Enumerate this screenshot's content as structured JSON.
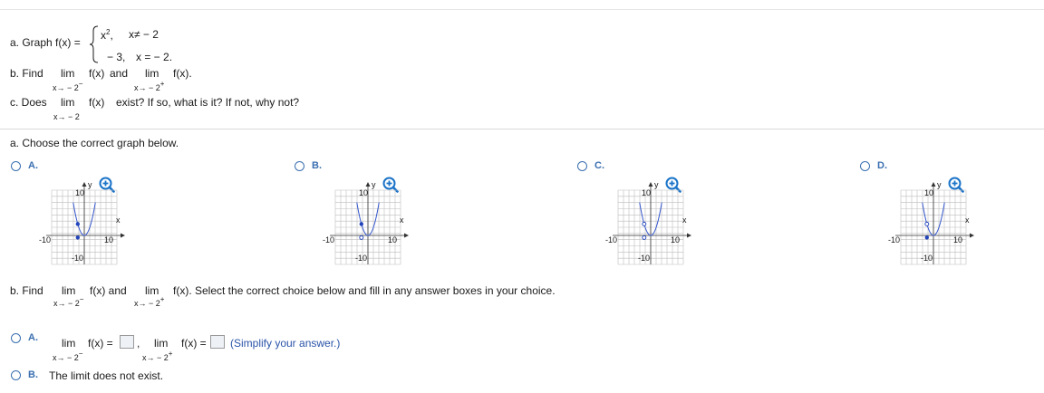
{
  "top_rule": true,
  "problem": {
    "part_a_label": "a. Graph f(x) =",
    "piece1_expr": "x",
    "piece1_exp": "2",
    "piece1_cond": "x≠ − 2",
    "piece2_expr": "− 3,",
    "piece2_cond": "x = − 2.",
    "part_b_label": "b. Find",
    "lim": "lim",
    "fx": "f(x)",
    "and": "and",
    "fx_period": "f(x).",
    "sub_left": "x→ − 2",
    "sub_left_sign": "−",
    "sub_right": "x→ − 2",
    "sub_right_sign": "+",
    "part_c_label": "c. Does",
    "part_c_rest": "exist? If so, what is it? If not, why not?",
    "sub_c": "x→ − 2"
  },
  "section_a": {
    "prompt": "a. Choose the correct graph below.",
    "options": [
      {
        "letter": "A.",
        "open_at_vertex": false,
        "dot_below": true
      },
      {
        "letter": "B.",
        "open_at_vertex": false,
        "dot_below": false
      },
      {
        "letter": "C.",
        "open_at_vertex": true,
        "dot_below": false
      },
      {
        "letter": "D.",
        "open_at_vertex": true,
        "dot_below": true
      }
    ],
    "graph_labels": {
      "y": "y",
      "x": "x",
      "top": "10",
      "left": "-10",
      "right": "10",
      "bottom": "-10"
    },
    "colors": {
      "curve": "#3355cc",
      "point": "#2244bb",
      "grid": "#bdbdbd",
      "zoom": "#1a73c8"
    },
    "zoom_icon": "zoom-in-icon"
  },
  "section_b": {
    "label": "b. Find",
    "lim": "lim",
    "fx_and": "f(x) and",
    "rest": "f(x). Select the correct choice below and fill in any answer boxes in your choice.",
    "sub_left": "x→ − 2",
    "sub_left_sign": "−",
    "sub_right": "x→ − 2",
    "sub_right_sign": "+",
    "choice_a_letter": "A.",
    "choice_a_lim1": "lim",
    "choice_a_fx1": "f(x) =",
    "choice_a_comma": ",",
    "choice_a_lim2": "lim",
    "choice_a_fx2": "f(x) =",
    "choice_a_hint": "(Simplify your answer.)",
    "choice_b_letter": "B.",
    "choice_b_text": "The limit does not exist."
  }
}
